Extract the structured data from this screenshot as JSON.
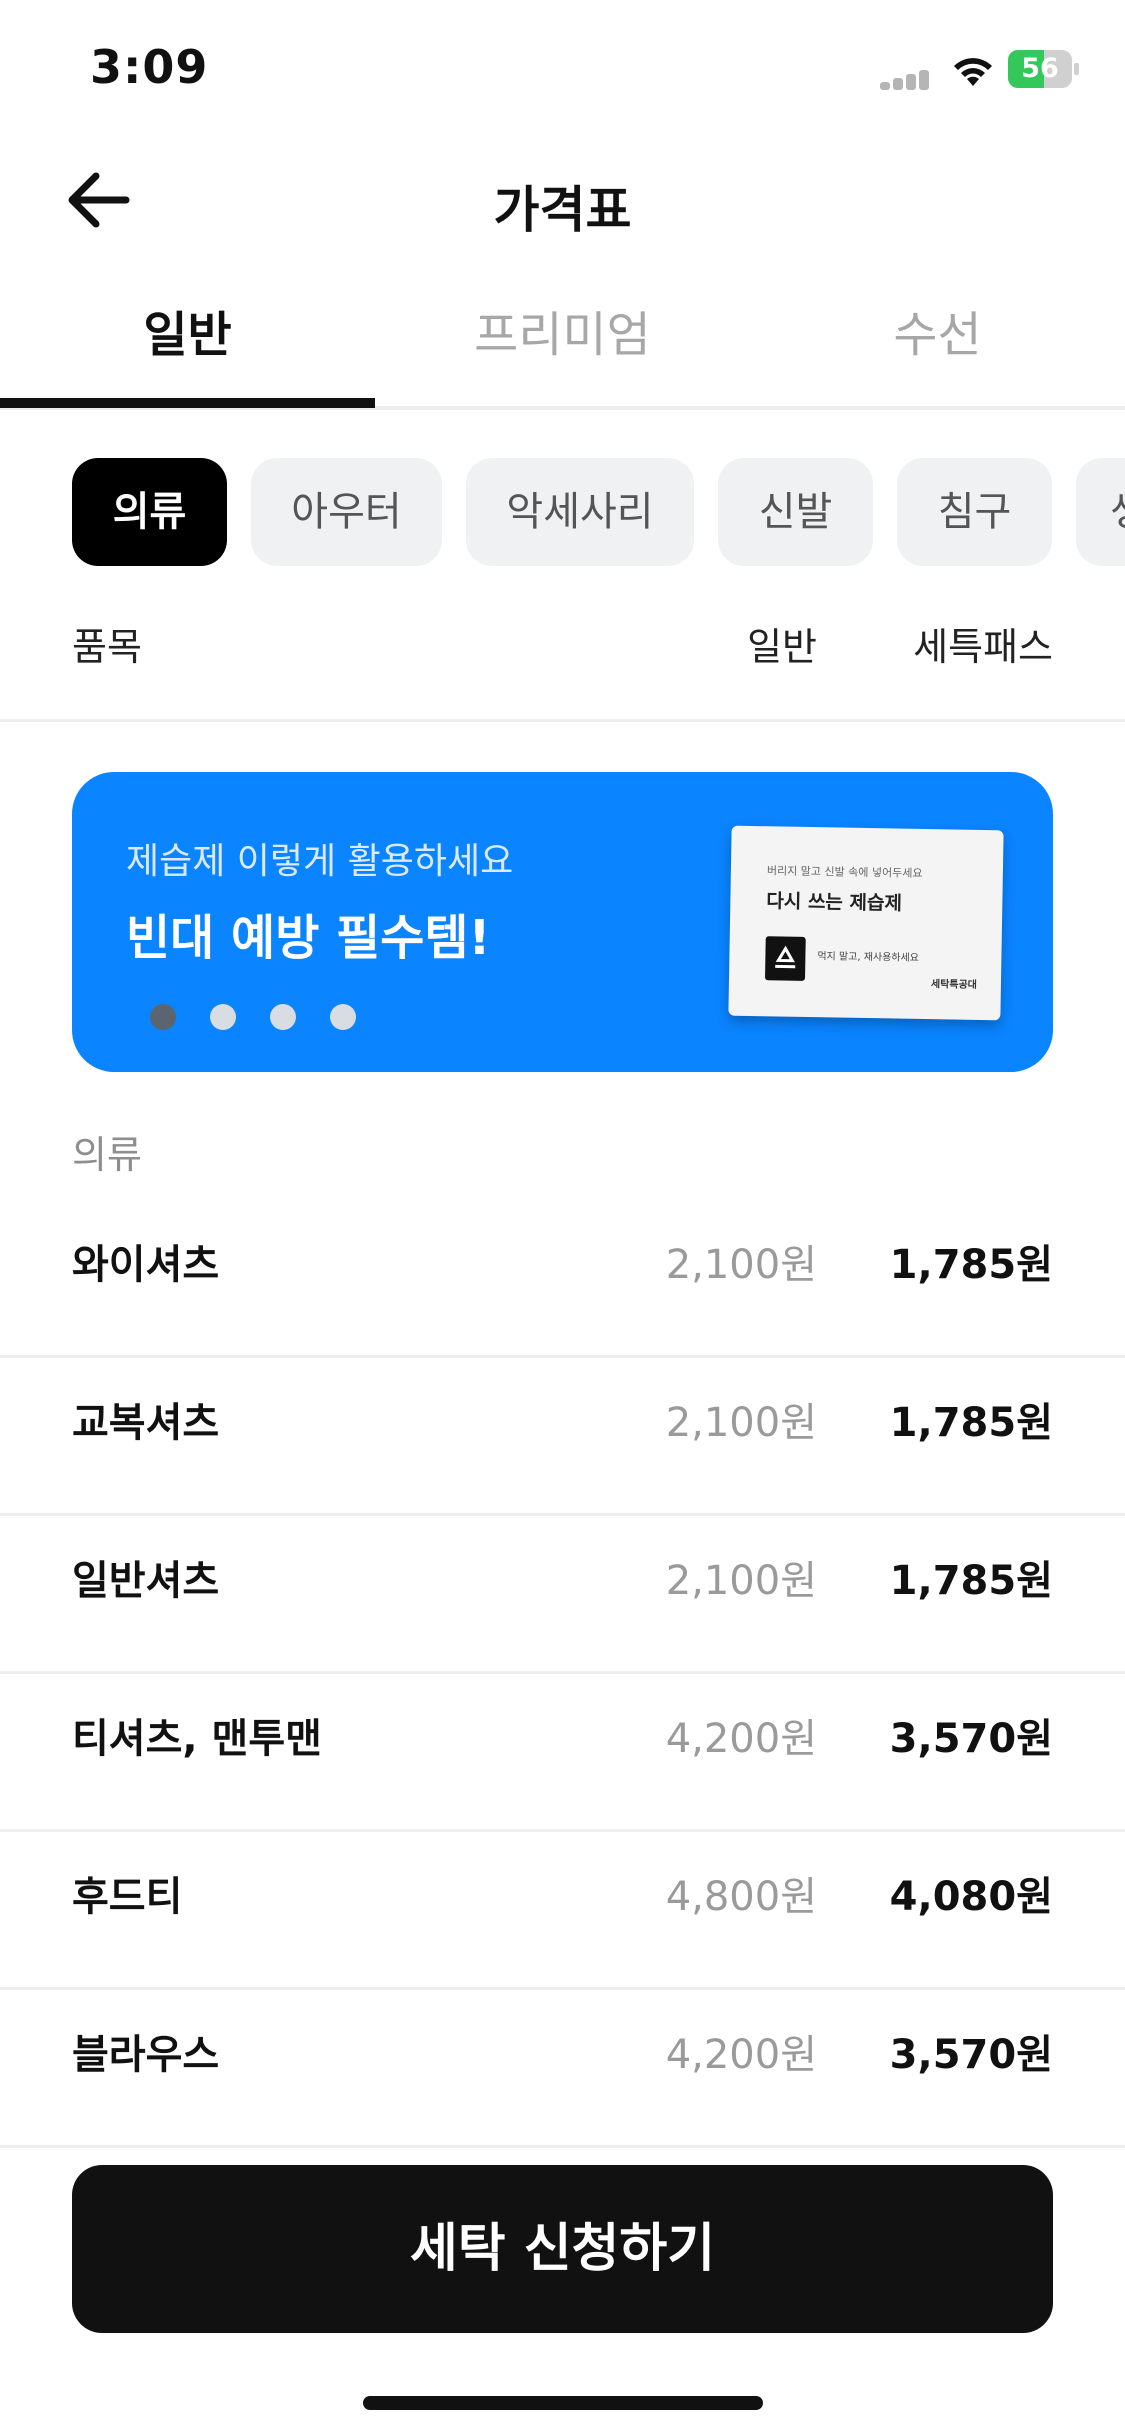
{
  "status_bar": {
    "time": "3:09",
    "battery_level": "56",
    "battery_fraction": 0.56,
    "battery_color": "#34c759"
  },
  "header": {
    "title": "가격표",
    "back_icon": "arrow-left-icon"
  },
  "tabs": [
    {
      "label": "일반",
      "active": true
    },
    {
      "label": "프리미엄",
      "active": false
    },
    {
      "label": "수선",
      "active": false
    }
  ],
  "categories": [
    {
      "label": "의류",
      "active": true
    },
    {
      "label": "아우터",
      "active": false
    },
    {
      "label": "악세사리",
      "active": false
    },
    {
      "label": "신발",
      "active": false
    },
    {
      "label": "침구",
      "active": false
    },
    {
      "label": "생",
      "active": false
    }
  ],
  "columns": {
    "item": "품목",
    "normal": "일반",
    "pass": "세특패스"
  },
  "banner": {
    "subtitle": "제습제 이렇게 활용하세요",
    "title": "빈대 예방 필수템!",
    "color": "#0a84ff",
    "page_count": 4,
    "active_page": 1,
    "product": {
      "small_text": "버리지 말고 신발 속에 넣어두세요",
      "name": "다시 쓰는 제습제",
      "note": "먹지 말고, 재사용하세요",
      "brand": "세탁특공대",
      "icon": "recycle-icon"
    }
  },
  "section": {
    "label": "의류"
  },
  "items": [
    {
      "name": "와이셔츠",
      "normal": "2,100원",
      "pass": "1,785원"
    },
    {
      "name": "교복셔츠",
      "normal": "2,100원",
      "pass": "1,785원"
    },
    {
      "name": "일반셔츠",
      "normal": "2,100원",
      "pass": "1,785원"
    },
    {
      "name": "티셔츠, 맨투맨",
      "normal": "4,200원",
      "pass": "3,570원"
    },
    {
      "name": "후드티",
      "normal": "4,800원",
      "pass": "4,080원"
    },
    {
      "name": "블라우스",
      "normal": "4,200원",
      "pass": "3,570원"
    }
  ],
  "cta": {
    "label": "세탁 신청하기"
  }
}
